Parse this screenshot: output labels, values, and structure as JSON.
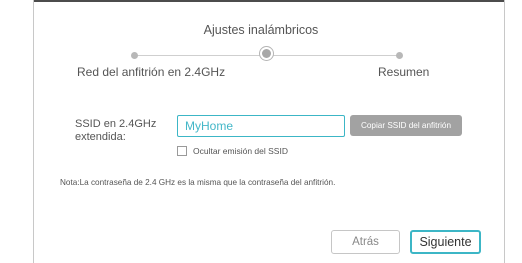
{
  "wizard": {
    "step_title": "Ajustes inalámbricos",
    "steps": [
      {
        "label": "Red del anfitrión en 2.4GHz",
        "state": "done"
      },
      {
        "label": "Ajustes inalámbricos",
        "state": "current"
      },
      {
        "label": "Resumen",
        "state": "pending"
      }
    ]
  },
  "form": {
    "ssid_label": "SSID en 2.4GHz\nextendida:",
    "ssid_value": "MyHome",
    "copy_button_label": "Copiar SSID del anfitrión",
    "hide_ssid_label": "Ocultar emisión del SSID",
    "hide_ssid_checked": false
  },
  "note": "Nota:La contraseña de 2.4 GHz es la misma que la contraseña del anfitrión.",
  "footer": {
    "back_label": "Atrás",
    "next_label": "Siguiente"
  },
  "colors": {
    "accent": "#3cb6c6",
    "disabled_button": "#a2a2a2"
  }
}
